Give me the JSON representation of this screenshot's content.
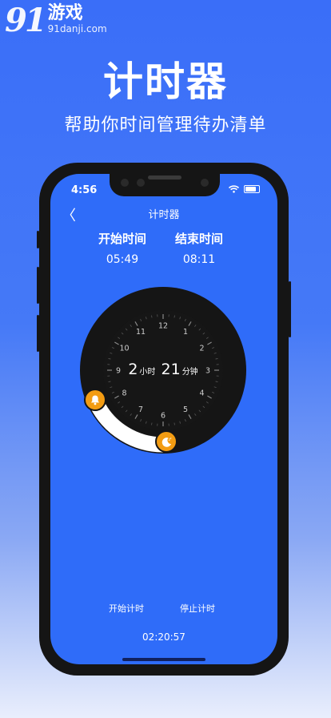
{
  "watermark": {
    "logo": "91",
    "brand": "游戏",
    "url": "91danji.com"
  },
  "promo": {
    "title": "计时器",
    "subtitle": "帮助你时间管理待办清单"
  },
  "status_bar": {
    "time": "4:56",
    "wifi_icon": "wifi-icon",
    "battery_icon": "battery-icon"
  },
  "nav": {
    "back_icon": "chevron-left-icon",
    "back_glyph": "〈",
    "title": "计时器"
  },
  "times": {
    "start": {
      "label": "开始时间",
      "value": "05:49"
    },
    "end": {
      "label": "结束时间",
      "value": "08:11"
    }
  },
  "dial": {
    "hours": "2",
    "hours_unit": "小时",
    "minutes": "21",
    "minutes_unit": "分钟",
    "numbers": [
      "12",
      "1",
      "2",
      "3",
      "4",
      "5",
      "6",
      "7",
      "8",
      "9",
      "10",
      "11"
    ],
    "start_handle_icon": "bell-icon",
    "end_handle_icon": "moon-icon"
  },
  "actions": {
    "start": "开始计时",
    "stop": "停止计时"
  },
  "stopwatch": "02:20:57",
  "colors": {
    "background": "#3a6ef8",
    "screen": "#2f6cf9",
    "dial": "#151515",
    "handle": "#f39c12",
    "arc": "#ffffff"
  }
}
